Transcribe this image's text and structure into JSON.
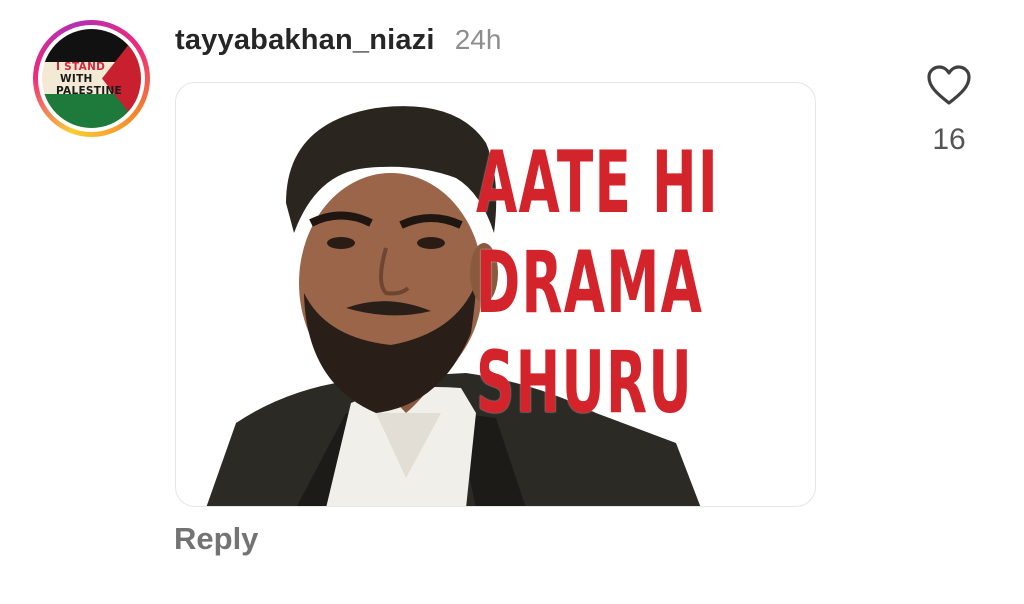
{
  "comment": {
    "avatar": {
      "icon": "profile-avatar",
      "badge_lines": [
        "I STAND",
        "WITH",
        "PALESTINE"
      ],
      "colors": {
        "red": "#d7263d",
        "green": "#1e7a3a",
        "black": "#111111",
        "cream": "#f3ead6"
      }
    },
    "username": "tayyabakhan_niazi",
    "timestamp": "24h",
    "sticker": {
      "lines": [
        "AATE HI",
        "DRAMA",
        "SHURU"
      ],
      "text_color": "#d3232b"
    },
    "like": {
      "icon": "heart-outline-icon",
      "count": "16"
    },
    "reply_label": "Reply"
  }
}
